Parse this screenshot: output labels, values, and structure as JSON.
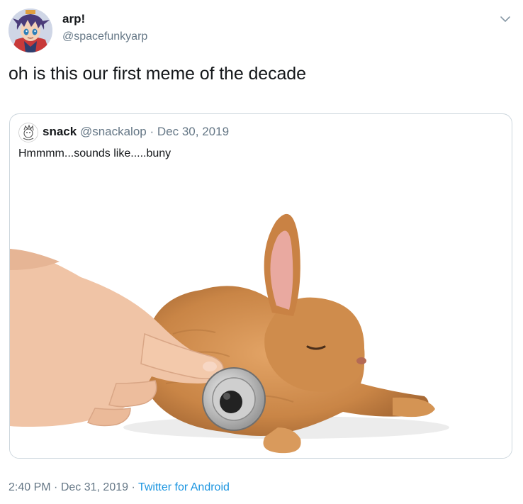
{
  "author": {
    "display_name": "arp!",
    "handle": "@spacefunkyarp"
  },
  "tweet": {
    "text": "oh is this our first meme of the decade"
  },
  "quoted_tweet": {
    "display_name": "snack",
    "handle": "@snackalop",
    "separator": "·",
    "date": "Dec 30, 2019",
    "text": "Hmmmm...sounds like.....buny"
  },
  "footer": {
    "time": "2:40 PM",
    "separator": "·",
    "date": "Dec 31, 2019",
    "source": "Twitter for Android"
  },
  "icons": {
    "menu": "chevron-down-icon"
  },
  "colors": {
    "text": "#14171a",
    "secondary_text": "#657786",
    "link": "#1b95e0",
    "border": "#ccd6dd"
  }
}
